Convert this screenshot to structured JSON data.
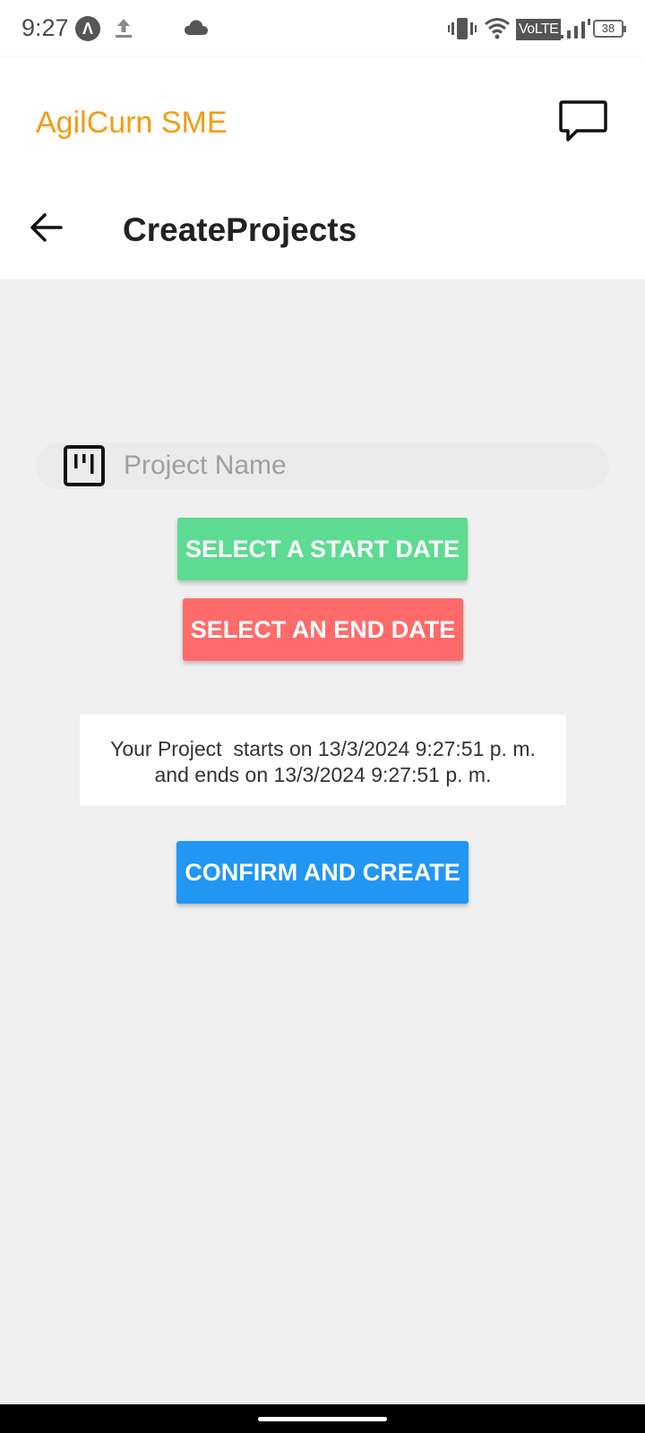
{
  "status_bar": {
    "time": "9:27",
    "badge": "Λ",
    "network": "VoLTE",
    "battery": "38"
  },
  "app_header": {
    "title": "AgilCurn SME",
    "accent_color": "#f39c12"
  },
  "sub_header": {
    "title": "CreateProjects"
  },
  "form": {
    "project_name": {
      "value": "",
      "placeholder": "Project Name"
    },
    "start_button_label": "SELECT A START DATE",
    "end_button_label": "SELECT AN END DATE",
    "summary_line1": "Your Project  starts on 13/3/2024 9:27:51 p. m.",
    "summary_line2": "and ends on 13/3/2024 9:27:51 p. m.",
    "confirm_button_label": "CONFIRM AND CREATE"
  },
  "colors": {
    "start_button": "#5ddb92",
    "end_button": "#ff6b6b",
    "confirm_button": "#2196f3",
    "background": "#f0f0f0"
  },
  "icons": {
    "badge": "app-notification-icon",
    "upload": "upload-icon",
    "cloud": "cloud-icon",
    "vibrate": "vibrate-icon",
    "wifi": "wifi-icon",
    "signal": "signal-icon",
    "battery": "battery-icon",
    "chat": "chat-bubble-icon",
    "back": "arrow-back-icon",
    "project": "kanban-board-icon"
  }
}
